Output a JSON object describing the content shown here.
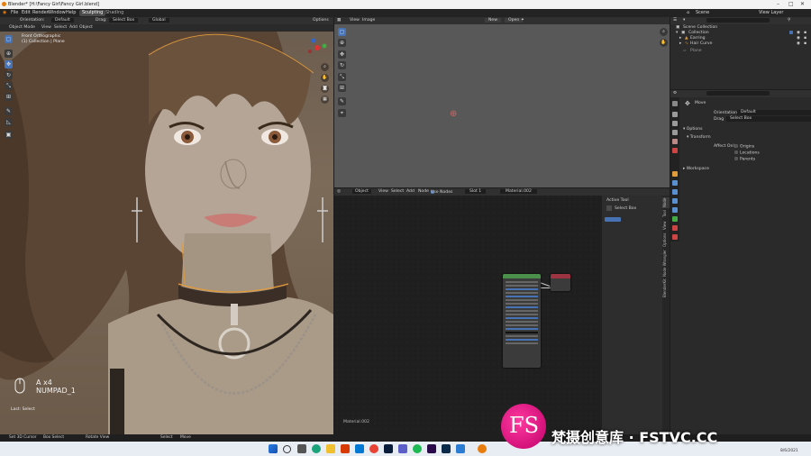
{
  "window": {
    "title": "Blender* [H:\\Fancy Girl\\Fancy Girl.blend]"
  },
  "topbar": {
    "menus": [
      "File",
      "Edit",
      "Render",
      "Window",
      "Help"
    ],
    "workspaces": [
      "Sculpting",
      "Shading"
    ],
    "scene_label": "Scene",
    "view_layer_label": "View Layer"
  },
  "viewport_header": {
    "orientation_label": "Orientation:",
    "orientation_value": "Default",
    "drag_label": "Drag:",
    "drag_value": "Select Box",
    "global_value": "Global",
    "options_label": "Options",
    "mode": "Object Mode",
    "menus": [
      "View",
      "Select",
      "Add",
      "Object"
    ]
  },
  "viewport": {
    "view_name": "Front Orthographic",
    "collection": "(1) Collection | Plane",
    "key_hint": "A x4",
    "key_hint2": "NUMPAD_1",
    "last_op": "Last: Select"
  },
  "image_editor": {
    "menus": [
      "View",
      "Image"
    ],
    "buttons": [
      "New",
      "Open"
    ]
  },
  "node_editor": {
    "menus": [
      "Object",
      "View",
      "Select",
      "Add",
      "Node"
    ],
    "use_nodes": "Use Nodes",
    "slot": "Slot 1",
    "material": "Material.002",
    "footer_material": "Material.002",
    "node_bsdf_title": "Principled BSDF",
    "node_output_title": "Material Output"
  },
  "node_sidebar": {
    "section": "Active Tool",
    "tool": "Select Box",
    "tabs": [
      "Node",
      "Tool",
      "View",
      "Options",
      "Node Wrangler",
      "BlenderKit"
    ]
  },
  "outliner": {
    "search_placeholder": "",
    "items": [
      {
        "label": "Scene Collection"
      },
      {
        "label": "Collection"
      },
      {
        "label": "Earring"
      },
      {
        "label": "Hair Curve"
      },
      {
        "label": "Plane"
      }
    ]
  },
  "properties": {
    "tool_name": "Move",
    "orientation_label": "Orientation",
    "orientation_value": "Default",
    "drag_label": "Drag",
    "drag_value": "Select Box",
    "options_label": "Options",
    "transform_label": "Transform",
    "affect_only": "Affect Only",
    "checks": [
      "Origins",
      "Locations",
      "Parents"
    ],
    "workspace_label": "Workspace"
  },
  "statusbar": {
    "items": [
      "Set 3D Cursor",
      "Box Select",
      "Rotate View",
      "Select",
      "Move"
    ]
  },
  "taskbar": {
    "time": "",
    "date": "8/6/2021"
  },
  "watermark": {
    "text": "梵摄创意库 · FSTVC.CC"
  },
  "colors": {
    "accent": "#4772b3",
    "node_green": "#4a8f4a",
    "node_red": "#9b3340",
    "watermark": "#e0007a"
  }
}
